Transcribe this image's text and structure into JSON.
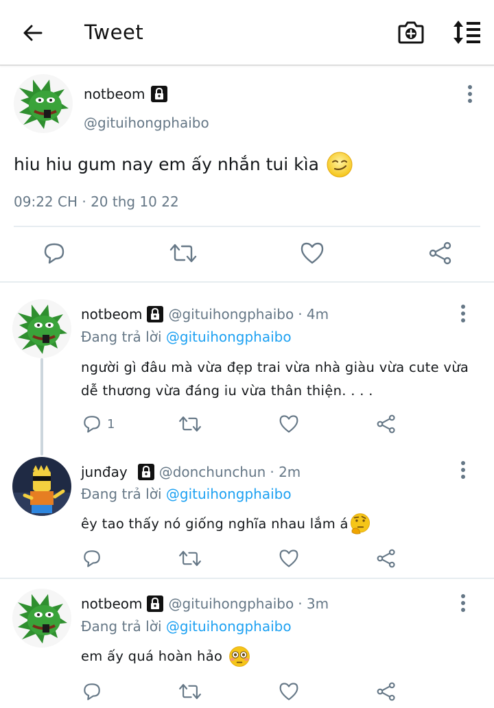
{
  "header": {
    "title": "Tweet",
    "back_icon": "arrow-left-icon",
    "camera_icon": "camera-plus-icon",
    "sort_icon": "sort-icon"
  },
  "main_tweet": {
    "name": "notbeom",
    "handle": "@gituihongphaibo",
    "text": "hiu hiu gum nay em ấy nhắn tui kìa",
    "emoji": "smirk-emoji",
    "timestamp": "09:22 CH · 20 thg 10 22"
  },
  "replies": [
    {
      "name": "notbeom",
      "handle": "@gituihongphaibo",
      "age": "· 4m",
      "replying_prefix": "Đang trả lời",
      "replying_to": "@gituihongphaibo",
      "text": "người gì đâu mà vừa đẹp trai vừa nhà giàu vừa cute vừa dễ thương vừa đáng iu vừa thân thiện. . . .",
      "reply_count": "1"
    },
    {
      "name": "junđay",
      "handle": "@donchunchun",
      "age": "· 2m",
      "replying_prefix": "Đang trả lời",
      "replying_to": "@gituihongphaibo",
      "text": "êy tao thấy nó giống nghĩa nhau lắm á",
      "emoji": "thinking-emoji",
      "reply_count": ""
    },
    {
      "name": "notbeom",
      "handle": "@gituihongphaibo",
      "age": "· 3m",
      "replying_prefix": "Đang trả lời",
      "replying_to": "@gituihongphaibo",
      "text": "em ấy quá hoàn hảo",
      "emoji": "flushed-emoji",
      "reply_count": ""
    }
  ],
  "colors": {
    "link": "#1da1f2",
    "secondary_text": "#657786",
    "divider": "#e6ecf0",
    "icon": "#657786"
  }
}
